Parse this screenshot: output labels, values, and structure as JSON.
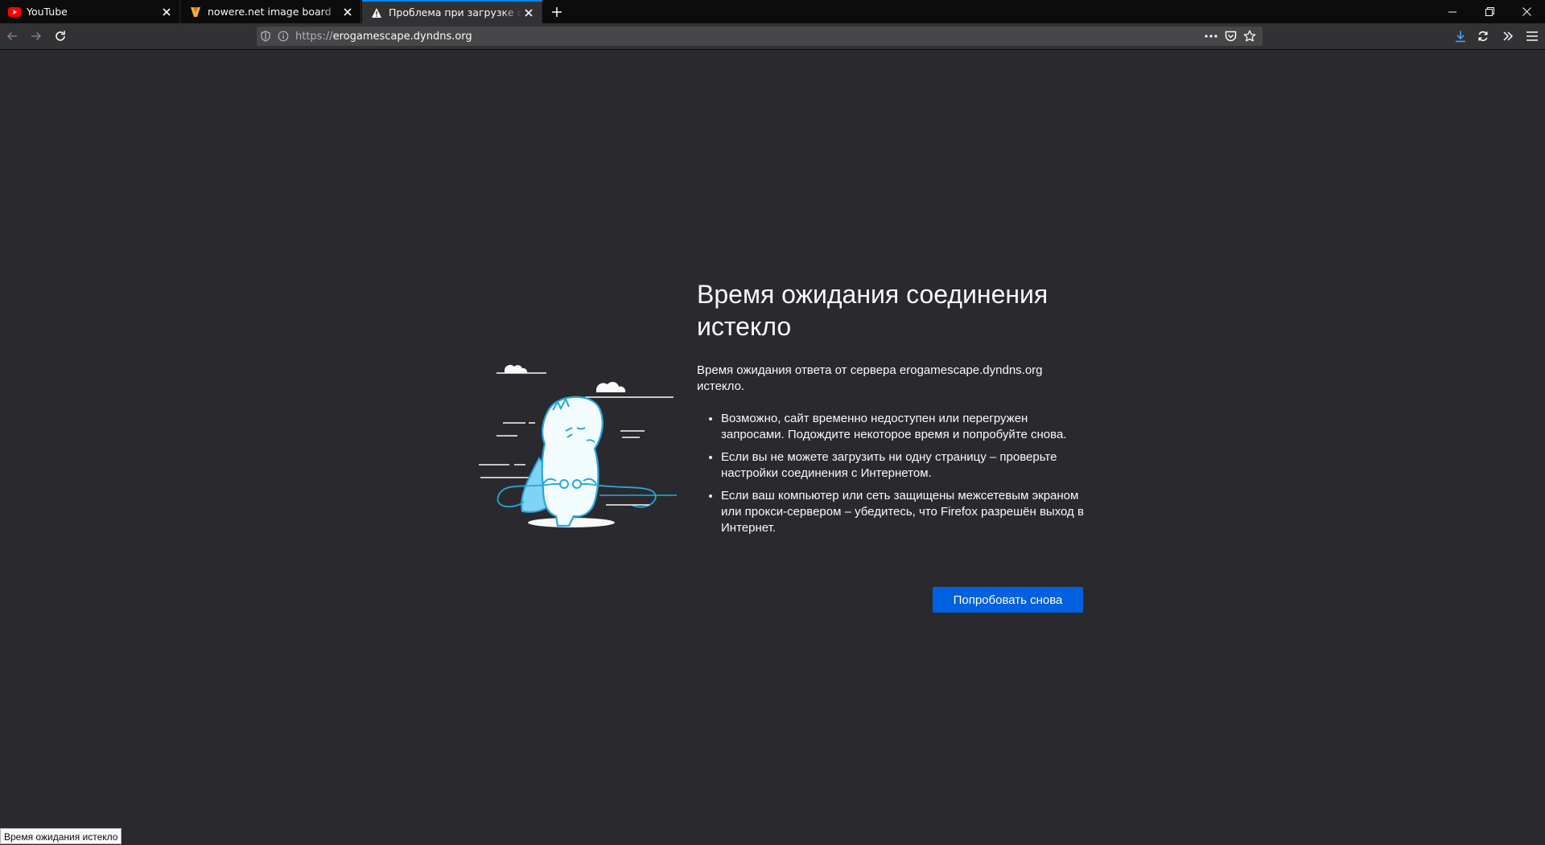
{
  "tabs": [
    {
      "title": "YouTube",
      "icon": "youtube-icon"
    },
    {
      "title": "nowere.net image board",
      "icon": "nowere-icon"
    },
    {
      "title": "Проблема при загрузке страницы",
      "icon": "warning-icon",
      "active": true
    }
  ],
  "url": {
    "scheme": "https://",
    "host": "erogamescape.dyndns.org"
  },
  "error": {
    "title": "Время ожидания соединения истекло",
    "description": "Время ожидания ответа от сервера erogamescape.dyndns.org истекло.",
    "suggestions": [
      "Возможно, сайт временно недоступен или перегружен запросами. Подождите некоторое время и попробуйте снова.",
      "Если вы не можете загрузить ни одну страницу – проверьте настройки соединения с Интернетом.",
      "Если ваш компьютер или сеть защищены межсетевым экраном или прокси-сервером – убедитесь, что Firefox разрешён выход в Интернет."
    ],
    "retry_label": "Попробовать снова"
  },
  "status_text": "Время ожидания истекло",
  "colors": {
    "accent": "#0a84ff",
    "button": "#0060df",
    "background": "#2a2a2e"
  }
}
